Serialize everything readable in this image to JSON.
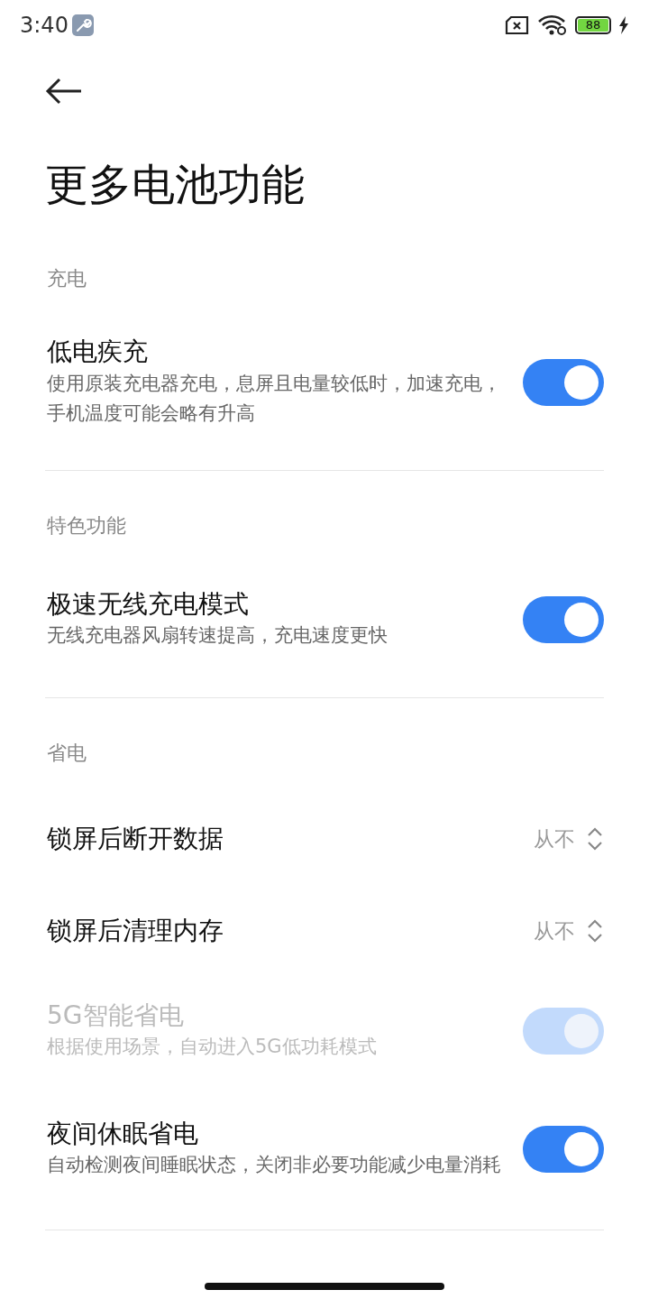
{
  "status_bar": {
    "time": "3:40",
    "battery": "88",
    "charging": true
  },
  "title": "更多电池功能",
  "sections": [
    {
      "header": "充电",
      "items": [
        {
          "kind": "toggle",
          "title": "低电疾充",
          "description": "使用原装充电器充电，息屏且电量较低时，加速充电，手机温度可能会略有升高",
          "on": true,
          "disabled": false
        }
      ]
    },
    {
      "header": "特色功能",
      "items": [
        {
          "kind": "toggle",
          "title": "极速无线充电模式",
          "description": "无线充电器风扇转速提高，充电速度更快",
          "on": true,
          "disabled": false
        }
      ]
    },
    {
      "header": "省电",
      "items": [
        {
          "kind": "select",
          "title": "锁屏后断开数据",
          "value": "从不"
        },
        {
          "kind": "select",
          "title": "锁屏后清理内存",
          "value": "从不"
        },
        {
          "kind": "toggle",
          "title": "5G智能省电",
          "description": "根据使用场景，自动进入5G低功耗模式",
          "on": true,
          "disabled": true
        },
        {
          "kind": "toggle",
          "title": "夜间休眠省电",
          "description": "自动检测夜间睡眠状态，关闭非必要功能减少电量消耗",
          "on": true,
          "disabled": false
        }
      ]
    }
  ]
}
